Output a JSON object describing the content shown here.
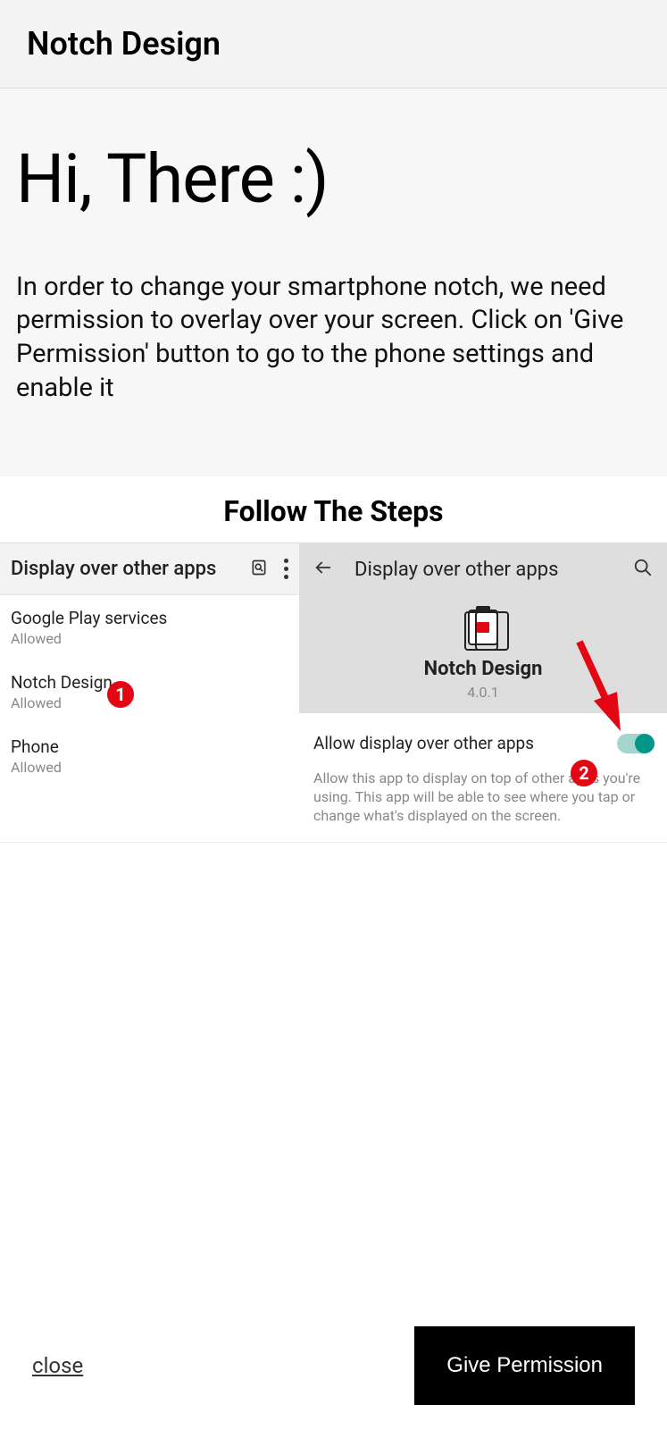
{
  "header": {
    "title": "Notch Design"
  },
  "intro": {
    "greeting": "Hi, There :)",
    "explain": "In order to change your smartphone notch, we need permission to overlay over your screen. Click on 'Give Permission' button to go to the phone settings and enable it"
  },
  "steps": {
    "title": "Follow The Steps",
    "left": {
      "header": "Display over other apps",
      "apps": [
        {
          "name": "Google Play services",
          "status": "Allowed"
        },
        {
          "name": "Notch Design",
          "status": "Allowed"
        },
        {
          "name": "Phone",
          "status": "Allowed"
        }
      ],
      "badge1": "1"
    },
    "right": {
      "header": "Display over other apps",
      "app_title": "Notch Design",
      "app_version": "4.0.1",
      "toggle_label": "Allow display over other apps",
      "note": "Allow this app to display on top of other apps you're using. This app will be able to see where you tap or change what's displayed on the screen.",
      "badge2": "2"
    }
  },
  "footer": {
    "close": "close",
    "give": "Give Permission"
  }
}
